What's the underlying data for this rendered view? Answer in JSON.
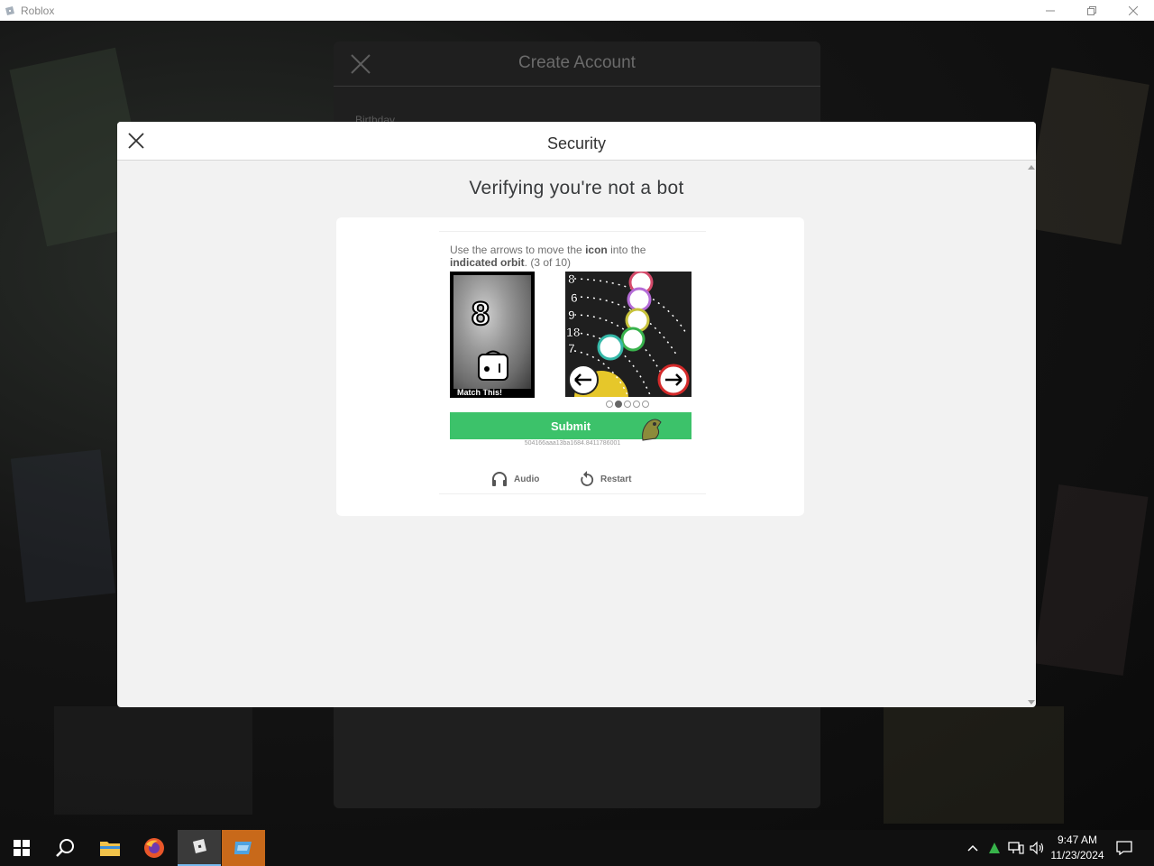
{
  "window": {
    "title": "Roblox"
  },
  "create_account": {
    "title": "Create Account",
    "birthday_label": "Birthday"
  },
  "security": {
    "title": "Security",
    "heading": "Verifying you're not a bot",
    "instruction_prefix": "Use the arrows to move the ",
    "instruction_icon": "icon",
    "instruction_middle": " into the ",
    "instruction_orbit": "indicated orbit",
    "instruction_progress": ". (3 of 10)",
    "match_number": "8",
    "match_label": "Match This!",
    "orbit_numbers": [
      "8",
      "6",
      "9",
      "18",
      "7"
    ],
    "page_dots": {
      "total": 5,
      "active": 2
    },
    "submit_label": "Submit",
    "session_id": "504166aaa13ba1684.8411786001",
    "audio_label": "Audio",
    "restart_label": "Restart"
  },
  "taskbar": {
    "time": "9:47 AM",
    "date": "11/23/2024",
    "apps": [
      "start-icon",
      "search-icon",
      "file-explorer-icon",
      "firefox-icon",
      "roblox-icon",
      "roblox-studio-icon"
    ]
  },
  "colors": {
    "submit": "#3cc26a",
    "modal_bg": "#f2f2f2",
    "taskbar": "#101010"
  }
}
